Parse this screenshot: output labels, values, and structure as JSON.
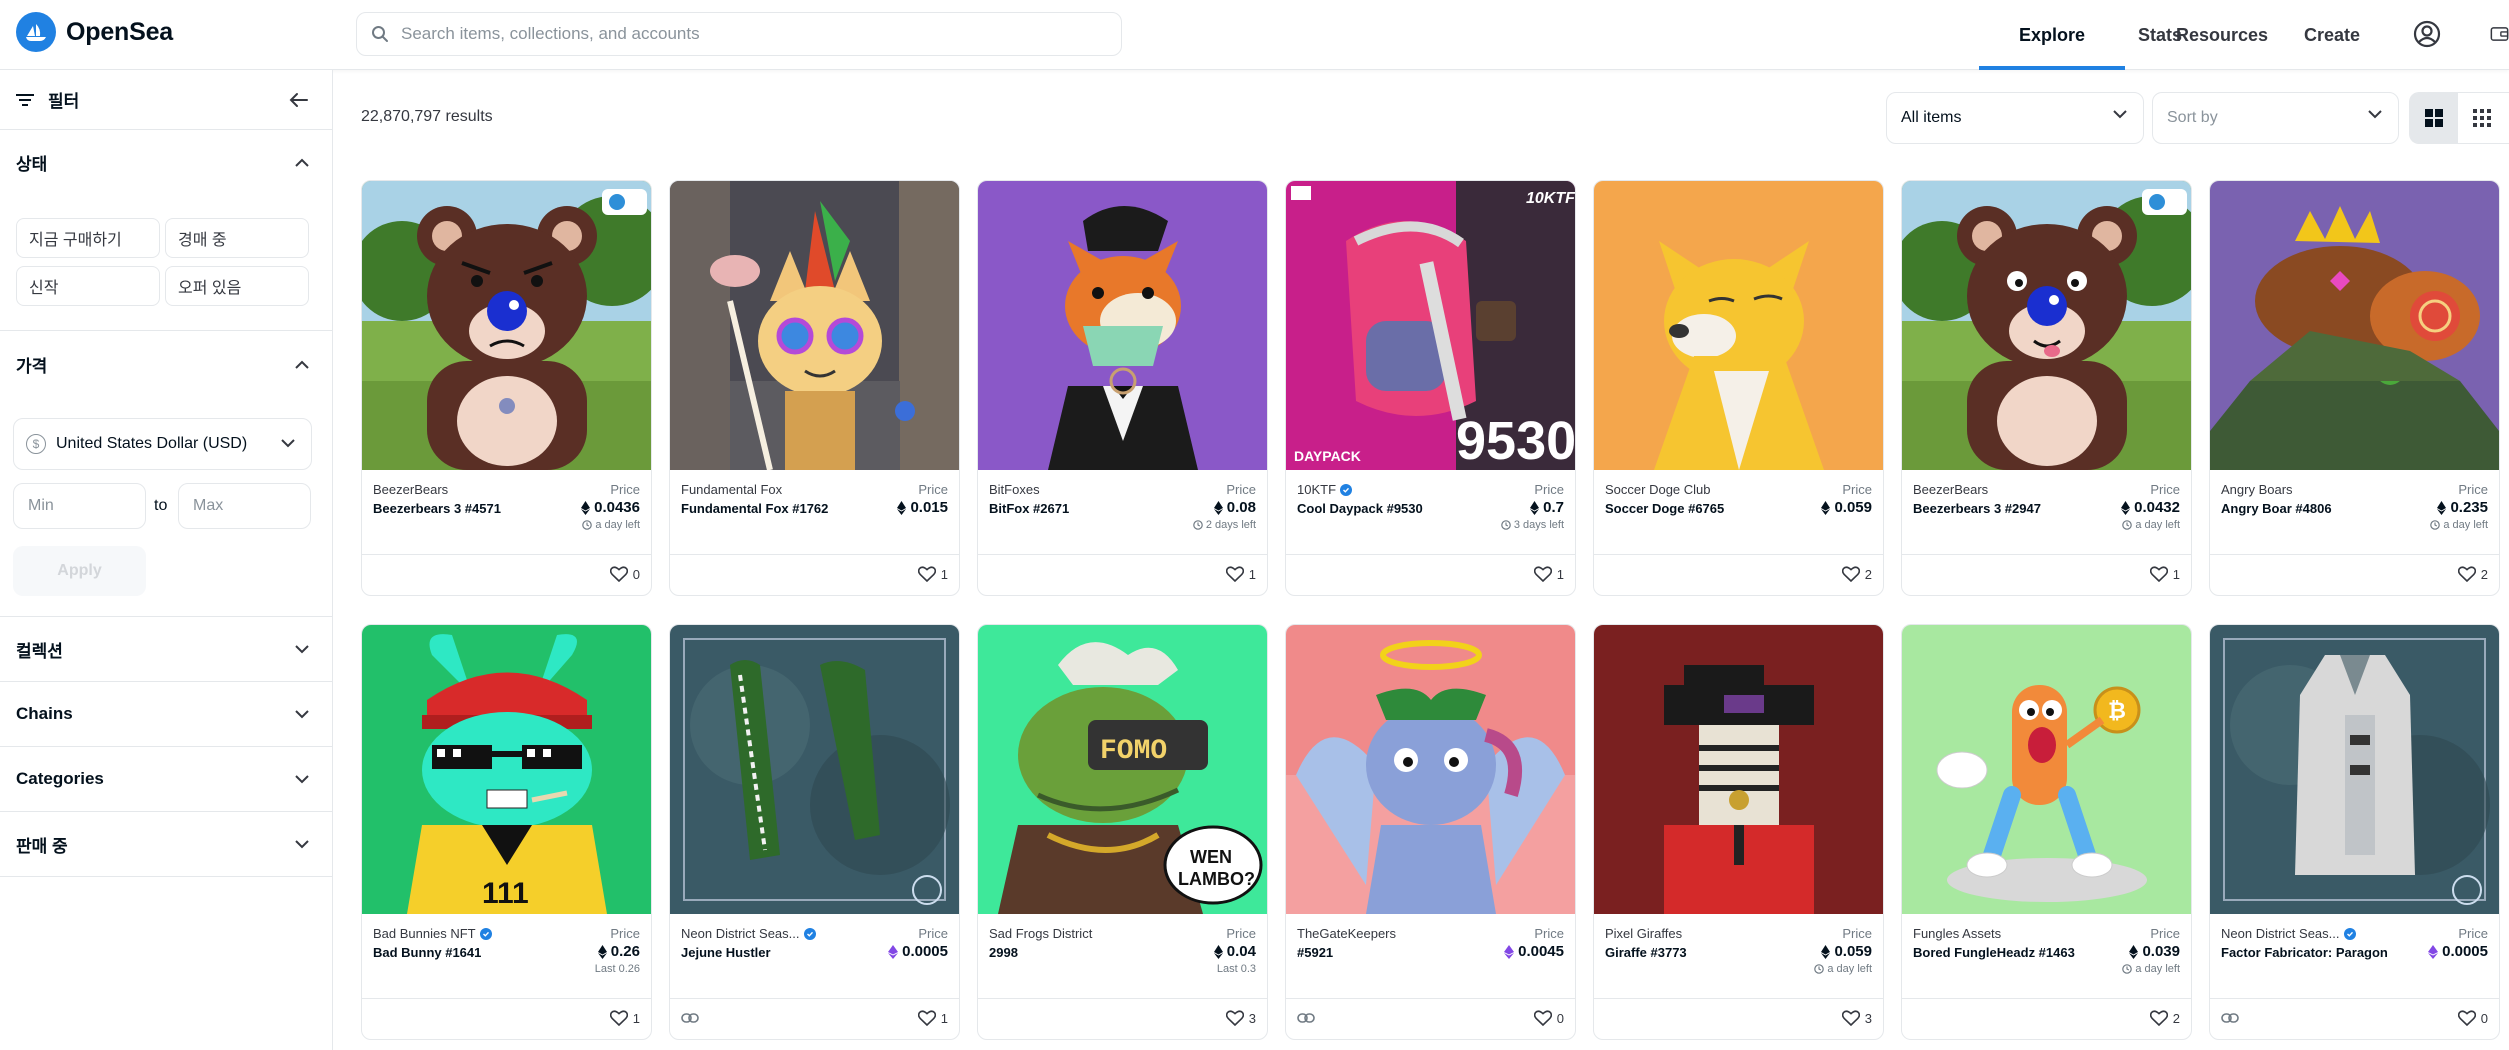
{
  "header": {
    "logo_text": "OpenSea",
    "search_placeholder": "Search items, collections, and accounts",
    "nav": [
      "Explore",
      "Stats",
      "Resources",
      "Create"
    ],
    "active_nav": "Explore"
  },
  "sidebar": {
    "filter_title": "필터",
    "status_title": "상태",
    "status_options": [
      "지금 구매하기",
      "경매 중",
      "신작",
      "오퍼 있음"
    ],
    "price_title": "가격",
    "currency": "United States Dollar (USD)",
    "currency_symbol": "$",
    "min_placeholder": "Min",
    "max_placeholder": "Max",
    "to_label": "to",
    "apply_label": "Apply",
    "sections": [
      "컬렉션",
      "Chains",
      "Categories",
      "판매 중"
    ]
  },
  "toolbar": {
    "results": "22,870,797 results",
    "items_dropdown": "All items",
    "sort_placeholder": "Sort by"
  },
  "colors": {
    "accent": "#2081e2",
    "text": "#04111d",
    "border": "#e5e8eb"
  },
  "cards": [
    {
      "collection": "BeezerBears",
      "verified": false,
      "name": "Beezerbears 3 #4571",
      "price_label": "Price",
      "price": "0.0436",
      "currency": "eth",
      "sub": "a day left",
      "favorites": "0",
      "image": "bear-teddy-blue"
    },
    {
      "collection": "Fundamental Fox",
      "verified": false,
      "name": "Fundamental Fox #1762",
      "price_label": "Price",
      "price": "0.015",
      "currency": "eth",
      "sub": "",
      "favorites": "1",
      "image": "fox-wizard"
    },
    {
      "collection": "BitFoxes",
      "verified": false,
      "name": "BitFox #2671",
      "price_label": "Price",
      "price": "0.08",
      "currency": "eth",
      "sub": "2 days left",
      "favorites": "1",
      "image": "fox-tuxedo"
    },
    {
      "collection": "10KTF",
      "verified": true,
      "name": "Cool Daypack #9530",
      "price_label": "Price",
      "price": "0.7",
      "currency": "eth",
      "sub": "3 days left",
      "favorites": "1",
      "image": "daypack",
      "image_text": [
        "DAYPACK",
        "9530",
        "10KTF"
      ]
    },
    {
      "collection": "Soccer Doge Club",
      "verified": false,
      "name": "Soccer Doge #6765",
      "price_label": "Price",
      "price": "0.059",
      "currency": "eth",
      "sub": "",
      "favorites": "2",
      "image": "doge-orange"
    },
    {
      "collection": "BeezerBears",
      "verified": false,
      "name": "Beezerbears 3 #2947",
      "price_label": "Price",
      "price": "0.0432",
      "currency": "eth",
      "sub": "a day left",
      "favorites": "1",
      "image": "bear-teddy-tongue"
    },
    {
      "collection": "Angry Boars",
      "verified": false,
      "name": "Angry Boar #4806",
      "price_label": "Price",
      "price": "0.235",
      "currency": "eth",
      "sub": "a day left",
      "favorites": "2",
      "image": "boar-crown"
    },
    {
      "collection": "Bad Bunnies NFT",
      "verified": true,
      "name": "Bad Bunny #1641",
      "price_label": "Price",
      "price": "0.26",
      "currency": "eth",
      "sub": "Last 0.26",
      "favorites": "1",
      "image": "bunny-cap"
    },
    {
      "collection": "Neon District Seas...",
      "verified": true,
      "name": "Jejune Hustler",
      "price_label": "Price",
      "price": "0.0005",
      "currency": "matic",
      "sub": "",
      "favorites": "1",
      "image": "neon-sleeves",
      "link_icon": true
    },
    {
      "collection": "Sad Frogs District",
      "verified": false,
      "name": "2998",
      "price_label": "Price",
      "price": "0.04",
      "currency": "eth",
      "sub": "Last 0.3",
      "favorites": "3",
      "image": "frog-fomo",
      "image_text": [
        "FOMO",
        "WEN",
        "LAMBO?"
      ]
    },
    {
      "collection": "TheGateKeepers",
      "verified": false,
      "name": "#5921",
      "price_label": "Price",
      "price": "0.0045",
      "currency": "matic",
      "sub": "",
      "favorites": "0",
      "image": "angel-goat",
      "link_icon": true
    },
    {
      "collection": "Pixel Giraffes",
      "verified": false,
      "name": "Giraffe #3773",
      "price_label": "Price",
      "price": "0.059",
      "currency": "eth",
      "sub": "a day left",
      "favorites": "3",
      "image": "pixel-giraffe"
    },
    {
      "collection": "Fungles Assets",
      "verified": false,
      "name": "Bored FungleHeadz #1463",
      "price_label": "Price",
      "price": "0.039",
      "currency": "eth",
      "sub": "a day left",
      "favorites": "2",
      "image": "fungle-coin"
    },
    {
      "collection": "Neon District Seas...",
      "verified": true,
      "name": "Factor Fabricator: Paragon",
      "price_label": "Price",
      "price": "0.0005",
      "currency": "matic",
      "sub": "",
      "favorites": "0",
      "image": "neon-vest",
      "link_icon": true
    }
  ]
}
